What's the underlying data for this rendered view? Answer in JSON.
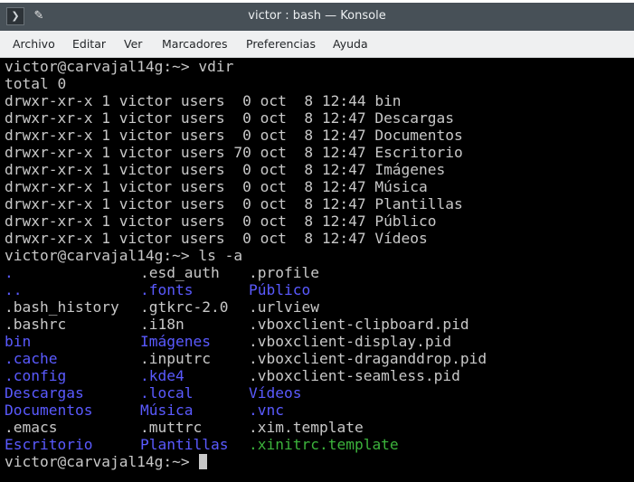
{
  "window": {
    "title": "victor : bash — Konsole",
    "app_icon": "terminal-icon",
    "pin_icon": "pin-icon"
  },
  "menubar": {
    "items": [
      "Archivo",
      "Editar",
      "Ver",
      "Marcadores",
      "Preferencias",
      "Ayuda"
    ]
  },
  "colors": {
    "titlebar": "#475057",
    "menubar": "#eff0f1",
    "terminal_bg": "#000000",
    "terminal_fg": "#c8c8c8",
    "directory": "#5a5aff",
    "executable": "#3cb33c"
  },
  "terminal": {
    "prompt_vdir": "victor@carvajal14g:~> vdir",
    "total": "total 0",
    "vdir_lines": [
      "drwxr-xr-x 1 victor users  0 oct  8 12:44 bin",
      "drwxr-xr-x 1 victor users  0 oct  8 12:47 Descargas",
      "drwxr-xr-x 1 victor users  0 oct  8 12:47 Documentos",
      "drwxr-xr-x 1 victor users 70 oct  8 12:47 Escritorio",
      "drwxr-xr-x 1 victor users  0 oct  8 12:47 Imágenes",
      "drwxr-xr-x 1 victor users  0 oct  8 12:47 Música",
      "drwxr-xr-x 1 victor users  0 oct  8 12:47 Plantillas",
      "drwxr-xr-x 1 victor users  0 oct  8 12:47 Público",
      "drwxr-xr-x 1 victor users  0 oct  8 12:47 Vídeos"
    ],
    "prompt_ls": "victor@carvajal14g:~> ls -a",
    "ls_rows": [
      [
        {
          "t": ".",
          "k": "dir"
        },
        {
          "t": ".esd_auth",
          "k": "file"
        },
        {
          "t": ".profile",
          "k": "file"
        }
      ],
      [
        {
          "t": "..",
          "k": "dir"
        },
        {
          "t": ".fonts",
          "k": "dir"
        },
        {
          "t": "Público",
          "k": "dir"
        }
      ],
      [
        {
          "t": ".bash_history",
          "k": "file"
        },
        {
          "t": ".gtkrc-2.0",
          "k": "file"
        },
        {
          "t": ".urlview",
          "k": "file"
        }
      ],
      [
        {
          "t": ".bashrc",
          "k": "file"
        },
        {
          "t": ".i18n",
          "k": "file"
        },
        {
          "t": ".vboxclient-clipboard.pid",
          "k": "file"
        }
      ],
      [
        {
          "t": "bin",
          "k": "dir"
        },
        {
          "t": "Imágenes",
          "k": "dir"
        },
        {
          "t": ".vboxclient-display.pid",
          "k": "file"
        }
      ],
      [
        {
          "t": ".cache",
          "k": "dir"
        },
        {
          "t": ".inputrc",
          "k": "file"
        },
        {
          "t": ".vboxclient-draganddrop.pid",
          "k": "file"
        }
      ],
      [
        {
          "t": ".config",
          "k": "dir"
        },
        {
          "t": ".kde4",
          "k": "dir"
        },
        {
          "t": ".vboxclient-seamless.pid",
          "k": "file"
        }
      ],
      [
        {
          "t": "Descargas",
          "k": "dir"
        },
        {
          "t": ".local",
          "k": "dir"
        },
        {
          "t": "Vídeos",
          "k": "dir"
        }
      ],
      [
        {
          "t": "Documentos",
          "k": "dir"
        },
        {
          "t": "Música",
          "k": "dir"
        },
        {
          "t": ".vnc",
          "k": "dir"
        }
      ],
      [
        {
          "t": ".emacs",
          "k": "file"
        },
        {
          "t": ".muttrc",
          "k": "file"
        },
        {
          "t": ".xim.template",
          "k": "file"
        }
      ],
      [
        {
          "t": "Escritorio",
          "k": "dir"
        },
        {
          "t": "Plantillas",
          "k": "dir"
        },
        {
          "t": ".xinitrc.template",
          "k": "exec"
        }
      ]
    ],
    "prompt_final": "victor@carvajal14g:~> "
  }
}
